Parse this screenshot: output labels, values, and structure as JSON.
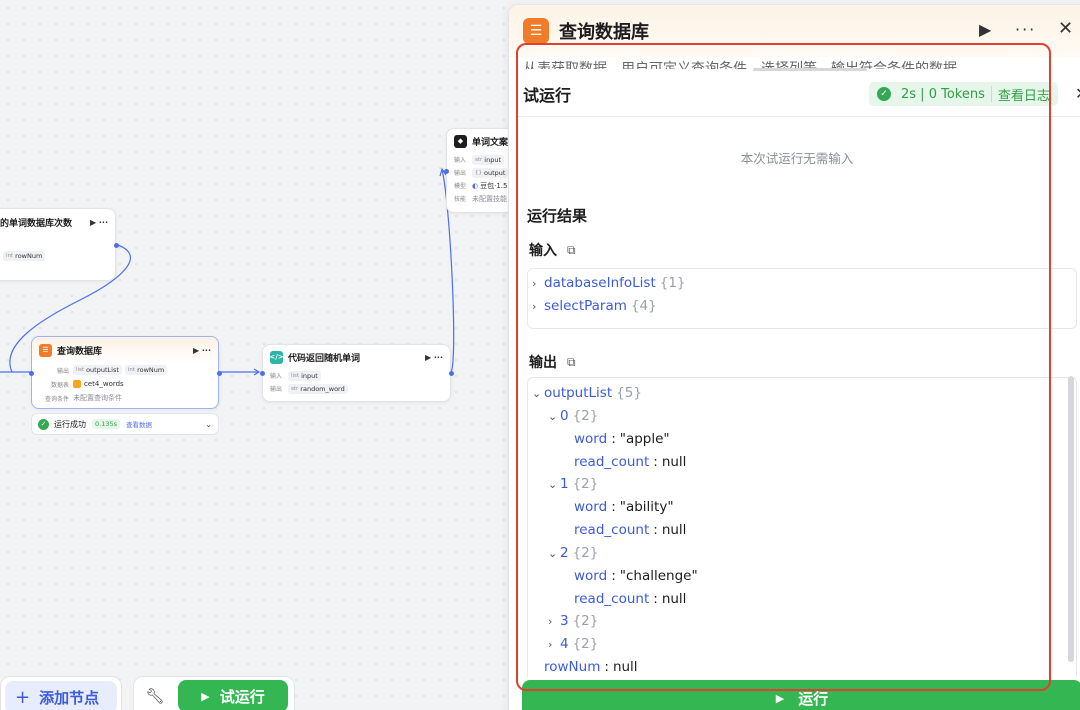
{
  "canvas": {
    "count_node": {
      "title": "的单词数据库次数",
      "actions": "▶ ···",
      "var_type": "int",
      "var_name": "rowNum"
    },
    "db_node": {
      "title": "查询数据库",
      "actions": "▶ ···",
      "output_label": "输出",
      "output_var_type": "list",
      "output_var": "outputList",
      "output_var2_type": "int",
      "output_var2": "rowNum",
      "database_label": "数据表",
      "database_name": "cet4_words",
      "condition_label": "查询条件",
      "condition_value": "未配置查询条件"
    },
    "code_node": {
      "title": "代码返回随机单词",
      "actions": "▶ ···",
      "input_label": "输入",
      "input_type": "list",
      "input_var": "input",
      "output_label": "输出",
      "output_type": "str",
      "output_var": "random_word"
    },
    "llm_node": {
      "title": "单词文案生",
      "input_label": "输入",
      "input_type": "str",
      "input_var": "input",
      "output_label": "输出",
      "output_type": "{}",
      "output_var": "output",
      "model_label": "模型",
      "model_name": "豆包·1.5",
      "skill_label": "技能",
      "skill_value": "未配置技能"
    },
    "status_card": {
      "text": "运行成功",
      "duration": "0.135s",
      "link": "查看数据"
    }
  },
  "toolbar": {
    "add_node_label": "添加节点",
    "test_run_label": "试运行"
  },
  "panel": {
    "title": "查询数据库",
    "description": "从表获取数据，用户可定义查询条件，选择列等，输出符合条件的数据",
    "test_run": {
      "title": "试运行",
      "status_time": "2s | 0 Tokens",
      "view_log": "查看日志",
      "no_input": "本次试运行无需输入",
      "result_title": "运行结果",
      "input_title": "输入",
      "output_title": "输出",
      "input_items": [
        {
          "key": "databaseInfoList",
          "count": "{1}"
        },
        {
          "key": "selectParam",
          "count": "{4}"
        }
      ],
      "output": {
        "root_key": "outputList",
        "root_count": "{5}",
        "items": [
          {
            "index": "0",
            "count": "{2}",
            "word_key": "word",
            "word": "\"apple\"",
            "read_key": "read_count",
            "read": "null"
          },
          {
            "index": "1",
            "count": "{2}",
            "word_key": "word",
            "word": "\"ability\"",
            "read_key": "read_count",
            "read": "null"
          },
          {
            "index": "2",
            "count": "{2}",
            "word_key": "word",
            "word": "\"challenge\"",
            "read_key": "read_count",
            "read": "null"
          }
        ],
        "collapsed": [
          {
            "index": "3",
            "count": "{2}"
          },
          {
            "index": "4",
            "count": "{2}"
          }
        ],
        "rownum_key": "rowNum",
        "rownum_value": "null"
      },
      "run_button": "运行"
    }
  },
  "colors": {
    "accent": "#4e6ef2",
    "success": "#34b653",
    "database": "#f07c2a",
    "highlight": "#e0402f"
  }
}
